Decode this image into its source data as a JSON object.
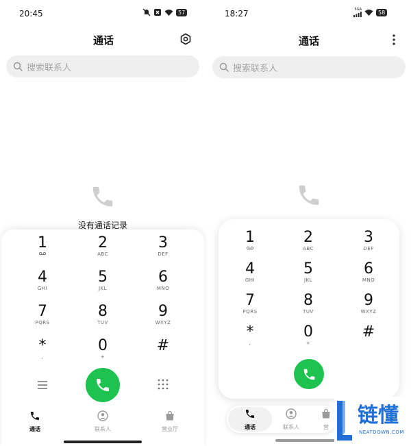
{
  "left": {
    "status_time": "20:45",
    "battery": "57",
    "title": "通话",
    "search_placeholder": "搜索联系人",
    "empty_text": "没有通话记录",
    "keys": [
      {
        "digit": "1",
        "letters": ""
      },
      {
        "digit": "2",
        "letters": "ABC"
      },
      {
        "digit": "3",
        "letters": "DEF"
      },
      {
        "digit": "4",
        "letters": "GHI"
      },
      {
        "digit": "5",
        "letters": "JKL"
      },
      {
        "digit": "6",
        "letters": "MNO"
      },
      {
        "digit": "7",
        "letters": "PQRS"
      },
      {
        "digit": "8",
        "letters": "TUV"
      },
      {
        "digit": "9",
        "letters": "WXYZ"
      },
      {
        "digit": "*",
        "letters": ","
      },
      {
        "digit": "0",
        "letters": "+"
      },
      {
        "digit": "#",
        "letters": ""
      }
    ],
    "nav": [
      {
        "label": "通话",
        "active": true,
        "icon": "phone-icon"
      },
      {
        "label": "联系人",
        "active": false,
        "icon": "contact-icon"
      },
      {
        "label": "营业厅",
        "active": false,
        "icon": "bag-icon"
      }
    ]
  },
  "right": {
    "status_time": "18:27",
    "network": "5GA",
    "battery": "58",
    "title": "通话",
    "search_placeholder": "搜索联系人",
    "keys": [
      {
        "digit": "1",
        "letters": ""
      },
      {
        "digit": "2",
        "letters": "ABC"
      },
      {
        "digit": "3",
        "letters": "DEF"
      },
      {
        "digit": "4",
        "letters": "GHI"
      },
      {
        "digit": "5",
        "letters": "JKL"
      },
      {
        "digit": "6",
        "letters": "MNO"
      },
      {
        "digit": "7",
        "letters": "PQRS"
      },
      {
        "digit": "8",
        "letters": "TUV"
      },
      {
        "digit": "9",
        "letters": "WXYZ"
      },
      {
        "digit": "*",
        "letters": ","
      },
      {
        "digit": "0",
        "letters": "+"
      },
      {
        "digit": "#",
        "letters": ""
      }
    ],
    "nav": [
      {
        "label": "通话",
        "active": true,
        "icon": "phone-icon"
      },
      {
        "label": "联系人",
        "active": false,
        "icon": "contact-icon"
      },
      {
        "label": "营",
        "active": false,
        "icon": "bag-icon"
      }
    ]
  },
  "watermark": {
    "brand_text": "链懂",
    "domain_text": "NEATDOWN.COM"
  },
  "colors": {
    "call_green": "#1ec24f",
    "search_bg": "#efefef",
    "placeholder": "#a8a8a8",
    "watermark_blue": "#1f6fd6"
  }
}
